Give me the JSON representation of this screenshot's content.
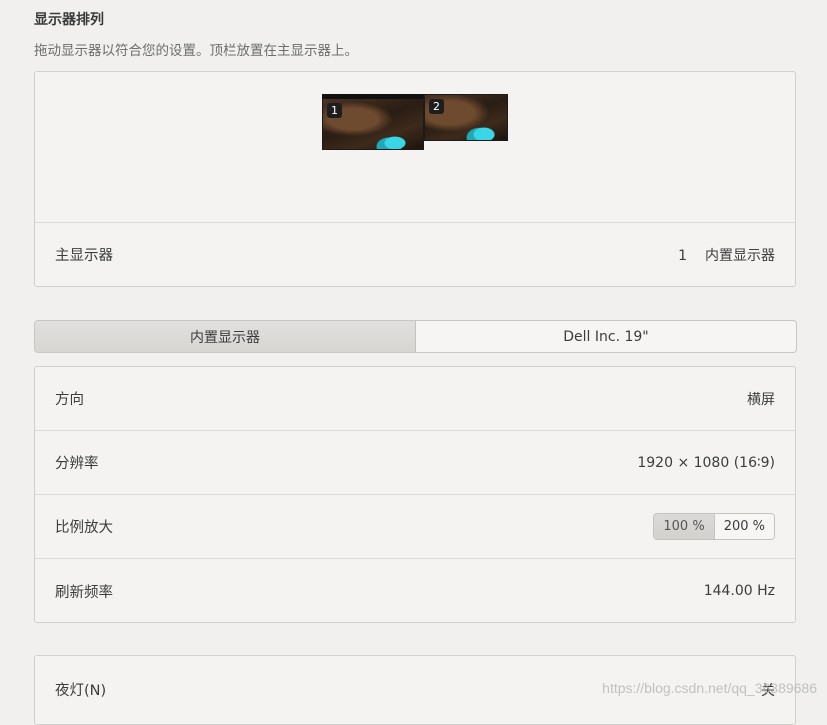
{
  "arrangement": {
    "title": "显示器排列",
    "description": "拖动显示器以符合您的设置。顶栏放置在主显示器上。",
    "monitors": [
      {
        "number": "1"
      },
      {
        "number": "2"
      }
    ],
    "primary": {
      "label": "主显示器",
      "number": "1",
      "name": "内置显示器"
    }
  },
  "display_tabs": [
    {
      "label": "内置显示器",
      "active": true
    },
    {
      "label": "Dell Inc. 19\"",
      "active": false
    }
  ],
  "settings": {
    "orientation": {
      "label": "方向",
      "value": "横屏"
    },
    "resolution": {
      "label": "分辨率",
      "value": "1920 × 1080 (16∶9)"
    },
    "scale": {
      "label": "比例放大",
      "options": [
        "100 %",
        "200 %"
      ],
      "selected": "100 %"
    },
    "refresh_rate": {
      "label": "刷新频率",
      "value": "144.00 Hz"
    }
  },
  "night_light": {
    "label": "夜灯(N)",
    "value": "关"
  },
  "watermark": "https://blog.csdn.net/qq_36389686"
}
